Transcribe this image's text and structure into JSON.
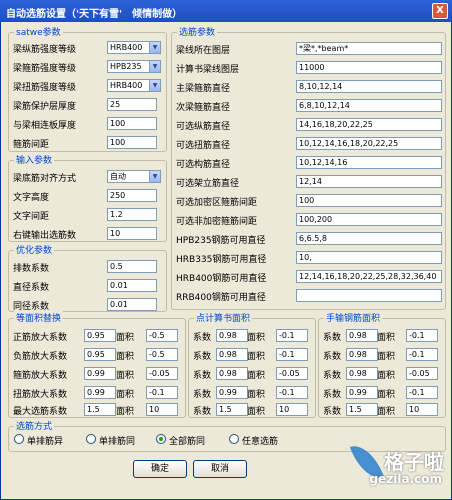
{
  "window": {
    "title": "自动选筋设置（'天下有雪'　倾情制做）",
    "close": "X"
  },
  "satwe": {
    "title": "satwe参数",
    "rows": [
      {
        "label": "梁纵筋强度等级",
        "value": "HRB400"
      },
      {
        "label": "梁箍筋强度等级",
        "value": "HPB235"
      },
      {
        "label": "梁扭筋强度等级",
        "value": "HRB400"
      }
    ],
    "cover_label": "梁筋保护层厚度",
    "cover_value": "25",
    "slab_label": "与梁相连板厚度",
    "slab_value": "100",
    "stirrup_label": "箍筋间距",
    "stirrup_value": "100"
  },
  "input": {
    "title": "输入参数",
    "align_label": "梁底筋对齐方式",
    "align_value": "自动",
    "text_height_label": "文字高度",
    "text_height_value": "250",
    "text_spacing_label": "文字间距",
    "text_spacing_value": "1.2",
    "right_count_label": "右键输出选筋数",
    "right_count_value": "10"
  },
  "optimize": {
    "title": "优化参数",
    "rows": [
      {
        "label": "排数系数",
        "value": "0.5"
      },
      {
        "label": "直径系数",
        "value": "0.01"
      },
      {
        "label": "同径系数",
        "value": "0.01"
      }
    ]
  },
  "rebar": {
    "title": "选筋参数",
    "rows": [
      {
        "label": "梁线所在图层",
        "value": "*梁*,*beam*"
      },
      {
        "label": "计算书梁线图层",
        "value": "11000"
      },
      {
        "label": "主梁箍筋直径",
        "value": "8,10,12,14"
      },
      {
        "label": "次梁箍筋直径",
        "value": "6,8,10,12,14"
      },
      {
        "label": "可选纵筋直径",
        "value": "14,16,18,20,22,25"
      },
      {
        "label": "可选扭筋直径",
        "value": "10,12,14,16,18,20,22,25"
      },
      {
        "label": "可选构筋直径",
        "value": "10,12,14,16"
      },
      {
        "label": "可选架立筋直径",
        "value": "12,14"
      },
      {
        "label": "可选加密区箍筋间距",
        "value": "100"
      },
      {
        "label": "可选非加密箍筋间距",
        "value": "100,200"
      },
      {
        "label": "HPB235钢筋可用直径",
        "value": "6,6.5,8"
      },
      {
        "label": "HRB335钢筋可用直径",
        "value": "10,"
      },
      {
        "label": "HRB400钢筋可用直径",
        "value": "12,14,16,18,20,22,25,28,32,36,40"
      },
      {
        "label": "RRB400钢筋可用直径",
        "value": ""
      }
    ]
  },
  "equal_area": {
    "title": "等面积替换",
    "area_label": "面积",
    "rows": [
      {
        "label": "正筋放大系数",
        "factor": "0.95",
        "area": "-0.5"
      },
      {
        "label": "负筋放大系数",
        "factor": "0.95",
        "area": "-0.5"
      },
      {
        "label": "箍筋放大系数",
        "factor": "0.99",
        "area": "-0.05"
      },
      {
        "label": "扭筋放大系数",
        "factor": "0.99",
        "area": "-0.1"
      },
      {
        "label": "最大选筋系数",
        "factor": "1.5",
        "area": "10"
      }
    ]
  },
  "calc_area": {
    "title": "点计算书面积",
    "factor_label": "系数",
    "area_label": "面积",
    "rows": [
      {
        "factor": "0.98",
        "area": "-0.1"
      },
      {
        "factor": "0.98",
        "area": "-0.1"
      },
      {
        "factor": "0.98",
        "area": "-0.05"
      },
      {
        "factor": "0.99",
        "area": "-0.1"
      },
      {
        "factor": "1.5",
        "area": "10"
      }
    ]
  },
  "manual_area": {
    "title": "手输钢筋面积",
    "factor_label": "系数",
    "area_label": "面积",
    "rows": [
      {
        "factor": "0.98",
        "area": "-0.1"
      },
      {
        "factor": "0.98",
        "area": "-0.1"
      },
      {
        "factor": "0.98",
        "area": "-0.05"
      },
      {
        "factor": "0.99",
        "area": "-0.1"
      },
      {
        "factor": "1.5",
        "area": "10"
      }
    ]
  },
  "method": {
    "title": "选筋方式",
    "options": [
      {
        "label": "单排筋异",
        "checked": false
      },
      {
        "label": "单排筋同",
        "checked": false
      },
      {
        "label": "全部筋同",
        "checked": true
      },
      {
        "label": "任意选筋",
        "checked": false
      }
    ]
  },
  "buttons": {
    "ok": "确定",
    "cancel": "取消"
  },
  "watermark": {
    "cn": "格子啦",
    "en": "gezila.com"
  }
}
